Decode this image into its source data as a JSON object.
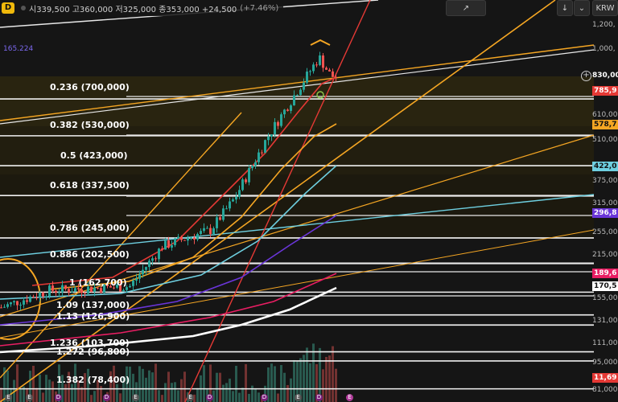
{
  "ohlc": {
    "symbol": "D",
    "text": "시339,500 고360,000 저325,000 종353,000 +24,500",
    "change": "(+7.46%)"
  },
  "toolbar": {
    "currency": "KRW",
    "download_icon": "download-icon",
    "expand_icon": "expand-icon",
    "draw_icon": "draw-icon"
  },
  "ma_label": "165.224",
  "fib_levels": [
    {
      "label": "0.236 (700,000)"
    },
    {
      "label": "0.382 (530,000)"
    },
    {
      "label": "0.5 (423,000)"
    },
    {
      "label": "0.618 (337,500)"
    },
    {
      "label": "0.786 (245,000)"
    },
    {
      "label": "0.886 (202,500)"
    },
    {
      "label": "1 (162,700)"
    },
    {
      "label": "1.09 (137,000)"
    },
    {
      "label": "1.13 (126,900)"
    },
    {
      "label": "1.236 (103,700)"
    },
    {
      "label": "1.272 (96,800)"
    },
    {
      "label": "1.382 (78,400)"
    }
  ],
  "axis_ticks": [
    "1,200,",
    "1,000,",
    "830,00",
    "610,00",
    "510,00",
    "375,00",
    "315,00",
    "255,00",
    "215,00",
    "155,00",
    "131,00",
    "111,00",
    "95,000",
    "81,000"
  ],
  "axis_tags": [
    {
      "text": "785,9",
      "color": "#e53935"
    },
    {
      "text": "578,7",
      "color": "#f5a623"
    },
    {
      "text": "422,0",
      "color": "#6ecfe0"
    },
    {
      "text": "296,8",
      "color": "#6a35d9"
    },
    {
      "text": "189,6",
      "color": "#e91e63"
    },
    {
      "text": "170,5",
      "color": "#ffffff"
    },
    {
      "text": "11,69",
      "color": "#e53935"
    }
  ],
  "chart_data": {
    "type": "candlestick",
    "log_scale": true,
    "last_price": "830,00",
    "series": [
      {
        "name": "price",
        "color": "#26a69a"
      },
      {
        "name": "MA",
        "color": "#e53935"
      },
      {
        "name": "MA",
        "color": "#f5a623"
      },
      {
        "name": "MA",
        "color": "#6ecfe0"
      },
      {
        "name": "MA",
        "color": "#6a35d9"
      },
      {
        "name": "MA",
        "color": "#e91e63"
      },
      {
        "name": "MA",
        "color": "#ffffff"
      }
    ],
    "fib_values": [
      700000,
      530000,
      423000,
      337500,
      245000,
      202500,
      162700,
      137000,
      126900,
      103700,
      96800,
      78400
    ]
  }
}
